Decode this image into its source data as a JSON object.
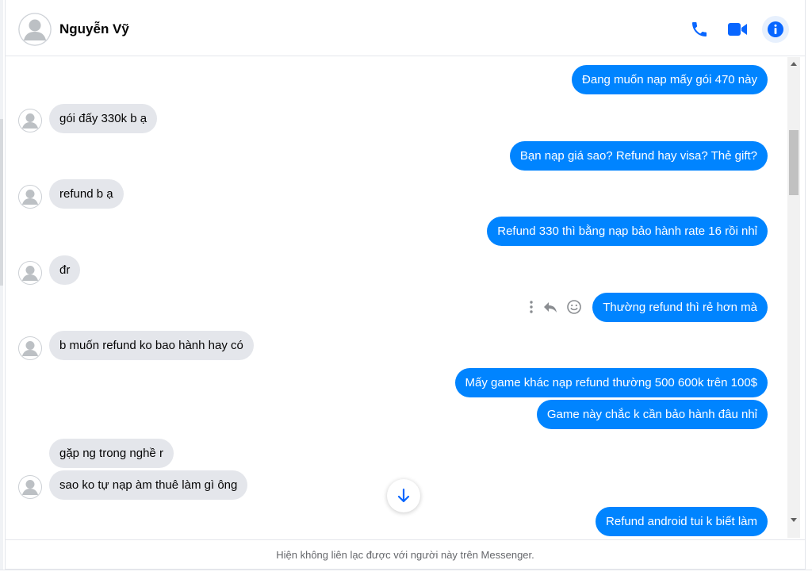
{
  "contact": {
    "name": "Nguyễn Vỹ"
  },
  "header_actions": [
    {
      "icon": "phone-icon"
    },
    {
      "icon": "video-camera-icon"
    },
    {
      "icon": "info-icon"
    }
  ],
  "messages": [
    {
      "side": "out",
      "text": "Đang muốn nạp mấy gói 470 này"
    },
    {
      "side": "in",
      "text": "gói đấy 330k b ạ"
    },
    {
      "side": "out",
      "text": "Bạn nạp giá sao? Refund hay visa? Thẻ gift?"
    },
    {
      "side": "in",
      "text": "refund b ạ"
    },
    {
      "side": "out",
      "text": "Refund 330 thì bằng nạp bảo hành rate 16 rồi nhỉ"
    },
    {
      "side": "in",
      "text": "đr"
    },
    {
      "side": "out",
      "text": "Thường refund thì rẻ hơn mà"
    },
    {
      "side": "in",
      "text": "b muốn refund ko bao hành hay có"
    },
    {
      "side": "out",
      "text": "Mấy game khác nạp refund thường 500 600k trên 100$"
    },
    {
      "side": "out",
      "text": "Game này chắc k cần bảo hành đâu nhỉ"
    },
    {
      "side": "in",
      "text": "gặp ng trong nghề r"
    },
    {
      "side": "in",
      "text": "sao ko tự nạp àm thuê làm gì ông"
    },
    {
      "side": "out",
      "text": "Refund android tui k biết làm"
    }
  ],
  "hover_tools": [
    "more-options-icon",
    "reply-icon",
    "react-smiley-icon"
  ],
  "footer": {
    "notice": "Hiện không liên lạc được với người này trên Messenger."
  },
  "colors": {
    "outgoing": "#0084ff",
    "incoming": "#e4e6eb",
    "accent": "#0866ff"
  }
}
